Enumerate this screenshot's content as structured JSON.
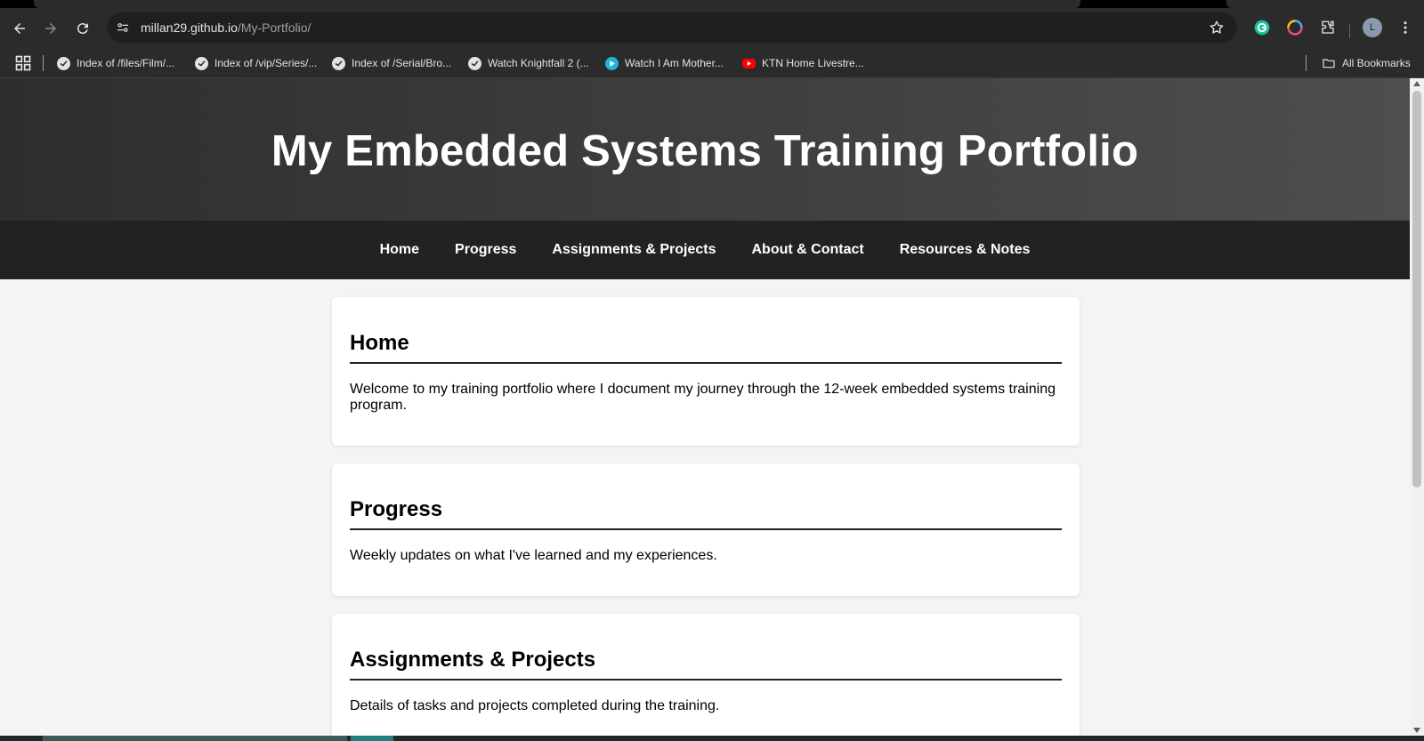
{
  "browser": {
    "url_host": "millan29.github.io",
    "url_path": "/My-Portfolio/",
    "avatar_letter": "L",
    "bookmarks": [
      {
        "label": "Index of /files/Film/..."
      },
      {
        "label": "Index of /vip/Series/..."
      },
      {
        "label": "Index of /Serial/Bro..."
      },
      {
        "label": "Watch Knightfall 2 (..."
      },
      {
        "label": "Watch I Am Mother..."
      },
      {
        "label": "KTN Home Livestre..."
      }
    ],
    "all_bookmarks": "All Bookmarks"
  },
  "site": {
    "title": "My Embedded Systems Training Portfolio",
    "nav": [
      {
        "label": "Home"
      },
      {
        "label": "Progress"
      },
      {
        "label": "Assignments & Projects"
      },
      {
        "label": "About & Contact"
      },
      {
        "label": "Resources & Notes"
      }
    ],
    "sections": [
      {
        "heading": "Home",
        "text": "Welcome to my training portfolio where I document my journey through the 12-week embedded systems training program."
      },
      {
        "heading": "Progress",
        "text": "Weekly updates on what I've learned and my experiences."
      },
      {
        "heading": "Assignments & Projects",
        "text": "Details of tasks and projects completed during the training."
      }
    ]
  },
  "colors": {
    "header_gradient_start": "#2e2e2e",
    "header_gradient_end": "#4e4e4e",
    "nav_bg": "#222222",
    "page_bg": "#f4f4f4",
    "card_bg": "#ffffff"
  },
  "icons": {
    "back": "back-arrow-icon",
    "forward": "forward-arrow-icon",
    "reload": "reload-icon",
    "site_info": "tune-icon",
    "bookmark_star": "star-icon",
    "apps": "apps-grid-icon",
    "folder": "folder-icon",
    "menu": "kebab-menu-icon"
  }
}
